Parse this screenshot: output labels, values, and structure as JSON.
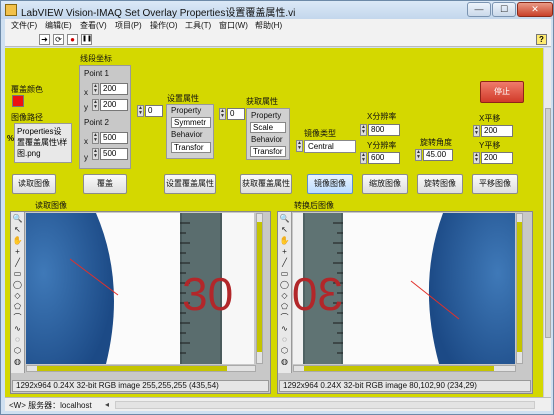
{
  "window": {
    "title": "LabVIEW Vision-IMAQ Set Overlay Properties设置覆盖属性.vi",
    "min_label": "—",
    "max_label": "☐",
    "close_label": "✕"
  },
  "menu": [
    "文件(F)",
    "编辑(E)",
    "查看(V)",
    "项目(P)",
    "操作(O)",
    "工具(T)",
    "窗口(W)",
    "帮助(H)"
  ],
  "toolbar": {
    "run_icon": "➜",
    "run_continuous_icon": "⟳",
    "abort_icon": "●",
    "pause_icon": "❚❚",
    "help": "?"
  },
  "front_panel": {
    "overlay_color_label": "覆盖颜色",
    "overlay_color": "#ee1111",
    "image_path_label": "图像路径",
    "image_path_value": "Properties设置覆盖属性\\样图.png",
    "image_path_icon": "%",
    "line_coords_label": "线段坐标",
    "point1_label": "Point 1",
    "point2_label": "Point 2",
    "x_label": "x",
    "y_label": "y",
    "p1_x": "200",
    "p1_y": "200",
    "p2_x": "500",
    "p2_y": "500",
    "set_props_label": "设置属性",
    "get_props_label": "获取属性",
    "set_index": "0",
    "get_index": "0",
    "set_items": [
      "Property",
      "Symmetr",
      "Behavior",
      "Transfor"
    ],
    "get_items": [
      "Property",
      "Scale",
      "Behavior",
      "Transfor"
    ],
    "mirror_type_label": "镜像类型",
    "mirror_type_value": "Central",
    "x_res_label": "X分辨率",
    "x_res_value": "800",
    "y_res_label": "Y分辨率",
    "y_res_value": "600",
    "rotation_label": "旋转角度",
    "rotation_value": "45.00",
    "x_shift_label": "X平移",
    "x_shift_value": "200",
    "y_shift_label": "Y平移",
    "y_shift_value": "200",
    "stop_label": "停止",
    "buttons": {
      "read_image": "读取图像",
      "overlay": "覆盖",
      "set_overlay_props": "设置覆盖属性",
      "get_overlay_props": "获取覆盖属性",
      "mirror_image": "镜像图像",
      "scale_image": "缩放图像",
      "rotate_image": "旋转图像",
      "translate_image": "平移图像"
    },
    "left_display_label": "读取图像",
    "right_display_label": "转换后图像",
    "left_status": "1292x964 0.24X 32-bit RGB image 255,255,255    (435,54)",
    "right_status": "1292x964 0.24X 32-bit RGB image 80,102,90    (234,29)",
    "ruler_digits": "30"
  },
  "statusbar": {
    "text": "<W> 服务器：localhost"
  },
  "tools": [
    "🔍",
    "↖",
    "✋",
    "+",
    "╱",
    "▭",
    "◯",
    "◇",
    "⬠",
    "⌒",
    "∿",
    "◌",
    "⬡",
    "◍",
    "⊕"
  ]
}
